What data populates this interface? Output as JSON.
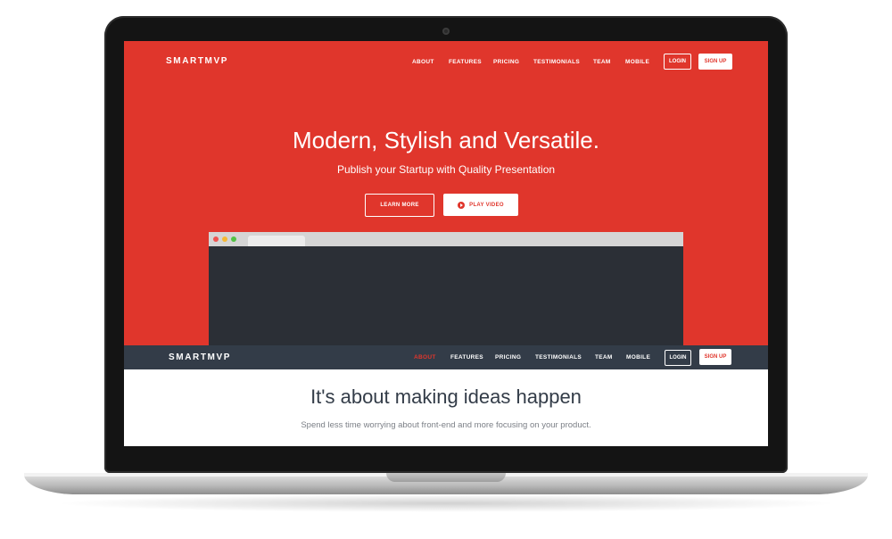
{
  "hero_nav": {
    "logo": "SMARTMVP",
    "links": [
      "ABOUT",
      "FEATURES",
      "PRICING",
      "TESTIMONIALS",
      "TEAM",
      "MOBILE"
    ],
    "login_label": "LOGIN",
    "signup_label": "SIGN UP"
  },
  "hero": {
    "headline": "Modern, Stylish and Versatile.",
    "subheadline": "Publish your Startup with Quality Presentation",
    "learn_more_label": "LEARN MORE",
    "play_video_label": "PLAY VIDEO"
  },
  "sticky_nav": {
    "logo": "SMARTMVP",
    "links": [
      "ABOUT",
      "FEATURES",
      "PRICING",
      "TESTIMONIALS",
      "TEAM",
      "MOBILE"
    ],
    "active_link": "ABOUT",
    "login_label": "LOGIN",
    "signup_label": "SIGN UP"
  },
  "about": {
    "title": "It's about making ideas happen",
    "text": "Spend less time worrying about front-end and more focusing on your product."
  },
  "colors": {
    "brand_red": "#e0362c",
    "dark_nav": "#333c48"
  },
  "icons": [
    "webcam-icon",
    "play-icon",
    "window-close-dot-icon",
    "window-minimize-dot-icon",
    "window-zoom-dot-icon"
  ]
}
